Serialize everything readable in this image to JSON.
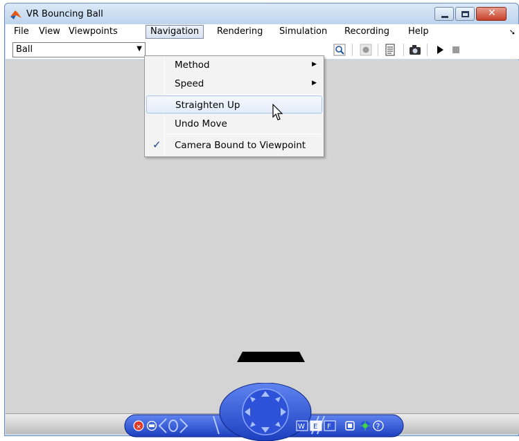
{
  "window": {
    "title": "VR Bouncing Ball"
  },
  "menubar": {
    "items": [
      "File",
      "View",
      "Viewpoints",
      "Navigation",
      "Rendering",
      "Simulation",
      "Recording",
      "Help"
    ],
    "active_index": 3
  },
  "toolbar": {
    "viewpoint_select_value": "Ball",
    "icons": [
      "zoom-icon",
      "record-icon",
      "properties-icon",
      "snapshot-icon",
      "play-icon",
      "stop-icon"
    ]
  },
  "navigation_menu": {
    "items": [
      {
        "label": "Method",
        "has_submenu": true,
        "checked": false
      },
      {
        "label": "Speed",
        "has_submenu": true,
        "checked": false
      },
      {
        "label": "Straighten Up",
        "has_submenu": false,
        "checked": false,
        "hovered": true
      },
      {
        "label": "Undo Move",
        "has_submenu": false,
        "checked": false
      },
      {
        "label": "Camera Bound to Viewpoint",
        "has_submenu": false,
        "checked": true
      }
    ]
  },
  "nav_panel": {
    "buttons": [
      "close-nav-icon",
      "minimize-nav-icon",
      "left-arrow-icon",
      "right-arrow-icon",
      "directional-pad",
      "walk-mode-button",
      "examine-mode-button",
      "fly-mode-button",
      "view-all-icon",
      "headlight-icon",
      "help-icon"
    ],
    "mode_labels": [
      "W",
      "E",
      "F"
    ],
    "help_label": "?"
  },
  "colors": {
    "canvas": "#d4d4d4",
    "nav_panel": "#2a4fd6",
    "checkmark": "#1b3f9a",
    "menu_hover": "#e2ecf9"
  }
}
